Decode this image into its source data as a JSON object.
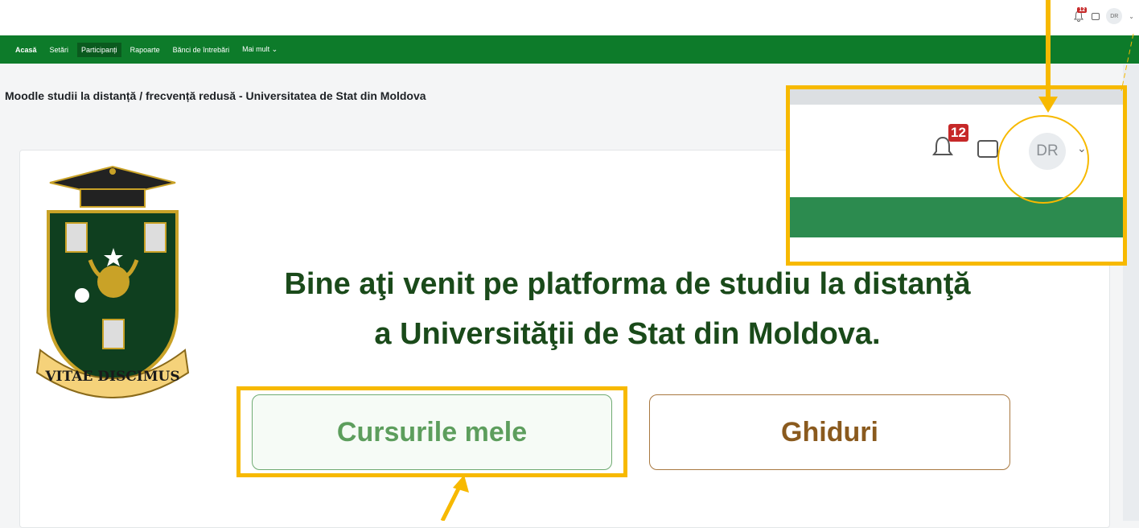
{
  "topbar": {
    "notification_count": "12",
    "avatar_initials": "DR"
  },
  "nav": {
    "items": [
      {
        "label": "Acasă"
      },
      {
        "label": "Setări"
      },
      {
        "label": "Participanți"
      },
      {
        "label": "Rapoarte"
      },
      {
        "label": "Bănci de întrebări"
      },
      {
        "label": "Mai mult ⌄"
      }
    ]
  },
  "page": {
    "title": "Moodle studii la distanță / frecvență redusă - Universitatea de Stat din Moldova"
  },
  "crest": {
    "motto": "VITAE DISCIMUS"
  },
  "welcome": {
    "line1": "Bine aţi venit pe platforma de studiu la distanţă",
    "line2": "a Universităţii de Stat din Moldova."
  },
  "buttons": {
    "courses": "Cursurile mele",
    "guides": "Ghiduri"
  },
  "zoom": {
    "notification_count": "12",
    "avatar_initials": "DR"
  },
  "colors": {
    "nav_green": "#0d7b2a",
    "highlight": "#f7b900",
    "welcome_text": "#1a4a1a",
    "courses_text": "#5d9e5d",
    "guides_text": "#8a5a1e"
  }
}
